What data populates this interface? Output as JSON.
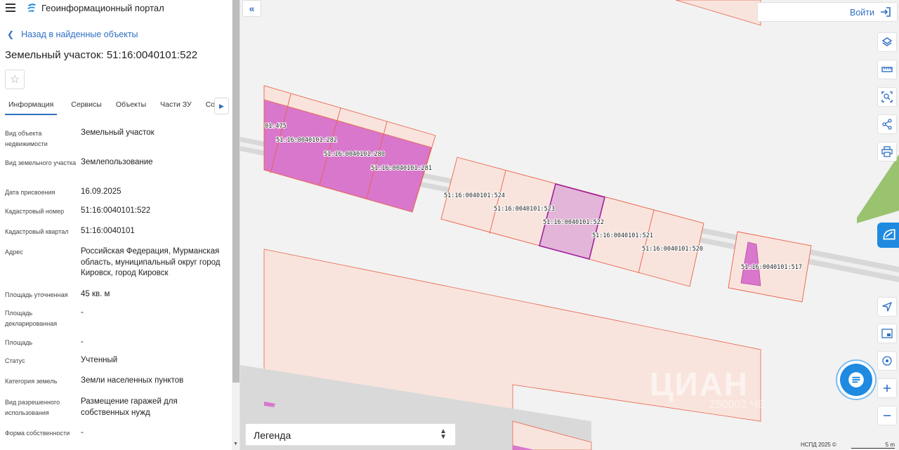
{
  "header": {
    "menu_icon": "hamburger-icon",
    "logo_icon": "portal-logo-icon",
    "app_title": "Геоинформационный портал"
  },
  "nav": {
    "back_label": "Назад в найденные объекты"
  },
  "object": {
    "title": "Земельный участок: 51:16:0040101:522",
    "favorite_icon": "star-icon"
  },
  "tabs": [
    "Информация",
    "Сервисы",
    "Объекты",
    "Части ЗУ",
    "Соста"
  ],
  "properties": [
    {
      "label": "Вид объекта недвижимости",
      "value": "Земельный участок"
    },
    {
      "label": "Вид земельного участка",
      "value": "Землепользование"
    },
    {
      "label": "Дата присвоения",
      "value": "16.09.2025"
    },
    {
      "label": "Кадастровый номер",
      "value": "51:16:0040101:522"
    },
    {
      "label": "Кадастровый квартал",
      "value": "51:16:0040101"
    },
    {
      "label": "Адрес",
      "value": "Российская Федерация, Мурманская область, муниципальный округ город Кировск, город Кировск"
    },
    {
      "label": "Площадь уточненная",
      "value": "45 кв. м"
    },
    {
      "label": "Площадь декларированная",
      "value": "-"
    },
    {
      "label": "Площадь",
      "value": "-"
    },
    {
      "label": "Статус",
      "value": "Учтенный"
    },
    {
      "label": "Категория земель",
      "value": "Земли населенных пунктов"
    },
    {
      "label": "Вид разрешенного использования",
      "value": "Размещение гаражей для собственных нужд"
    },
    {
      "label": "Форма собственности",
      "value": "-"
    }
  ],
  "map": {
    "login_label": "Войти",
    "legend_label": "Легенда",
    "attribution": "НСПД 2025 ©",
    "scale_label": "5 m",
    "watermark": "ЦИАН",
    "watermark_sub": "250002 ЧЕ",
    "parcel_labels": [
      "01:475",
      "51:16:0040101:282",
      "51:16:0040101:280",
      "51:16:0040101:281",
      "51:16:0040101:524",
      "51:16:0040101:523",
      "51:16:0040101:522",
      "51:16:0040101:521",
      "51:16:0040101:520",
      "51:16:0040101:517"
    ],
    "tools": [
      "layers-icon",
      "ruler-icon",
      "select-area-icon",
      "share-icon",
      "print-icon",
      "locate-icon",
      "minimap-icon",
      "gps-icon",
      "zoom-in-icon",
      "zoom-out-icon"
    ],
    "colors": {
      "parcel_fill": "#f9e4dd",
      "parcel_stroke": "#e8634a",
      "selected_fill": "#e3b5d8",
      "selected_stroke": "#a020a0",
      "magenta": "#d877cc",
      "green": "#9ac36f",
      "accent": "#2f6fc4"
    }
  }
}
